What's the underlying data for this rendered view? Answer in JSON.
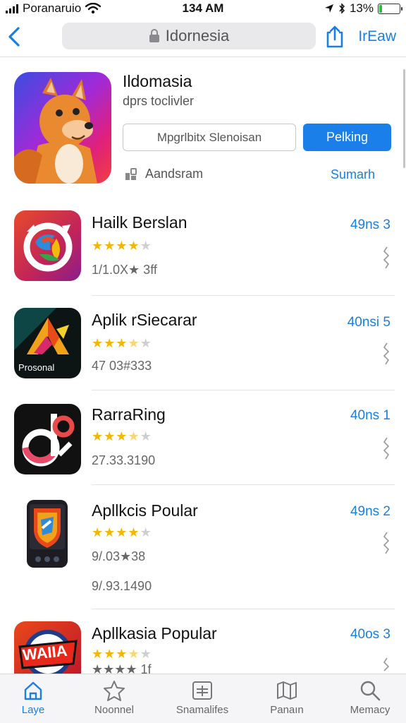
{
  "status_bar": {
    "carrier": "Poranaruio",
    "time": "134 AM",
    "battery": "13%",
    "battery_level": 0.13
  },
  "nav": {
    "search_text": "Idornesia",
    "right_label": "IrEaw"
  },
  "featured": {
    "title": "Ildomasia",
    "subtitle": "dprs toclivler",
    "secondary_button": "Mpgrlbitx Slenoisan",
    "primary_button": "Pelking",
    "meta_text": "Aandsram",
    "link_text": "Sumarh"
  },
  "apps": [
    {
      "name": "Hailk Berslan",
      "rating": 4,
      "count": "1/1.0X★ 3ff",
      "get_label": "49ns 3"
    },
    {
      "name": "Aplik rSiecarar",
      "rating": 3.5,
      "count": "47 03#333",
      "get_label": "40nsi 5",
      "icon_text": "Prosonal"
    },
    {
      "name": "RarraRing",
      "rating": 3.5,
      "count": "27.33.3190",
      "get_label": "40ns 1"
    },
    {
      "name": "Apllkcis Poular",
      "rating": 4,
      "count": "9/.03★38",
      "extra": "9/.93.1490",
      "get_label": "49ns 2"
    },
    {
      "name": "Apllkasia Popular",
      "rating": 3.5,
      "count": "★★★★ 1f",
      "get_label": "40os 3",
      "icon_text": "WAIIA"
    }
  ],
  "tabs": [
    {
      "label": "Laye",
      "icon": "home-icon",
      "active": true
    },
    {
      "label": "Noonnel",
      "icon": "star-icon",
      "active": false
    },
    {
      "label": "Snamalifes",
      "icon": "list-icon",
      "active": false
    },
    {
      "label": "Panaın",
      "icon": "map-icon",
      "active": false
    },
    {
      "label": "Memacy",
      "icon": "search-icon",
      "active": false
    }
  ],
  "colors": {
    "accent": "#1a7fe0",
    "star": "#f2b705",
    "battery": "#2fbf3f"
  }
}
